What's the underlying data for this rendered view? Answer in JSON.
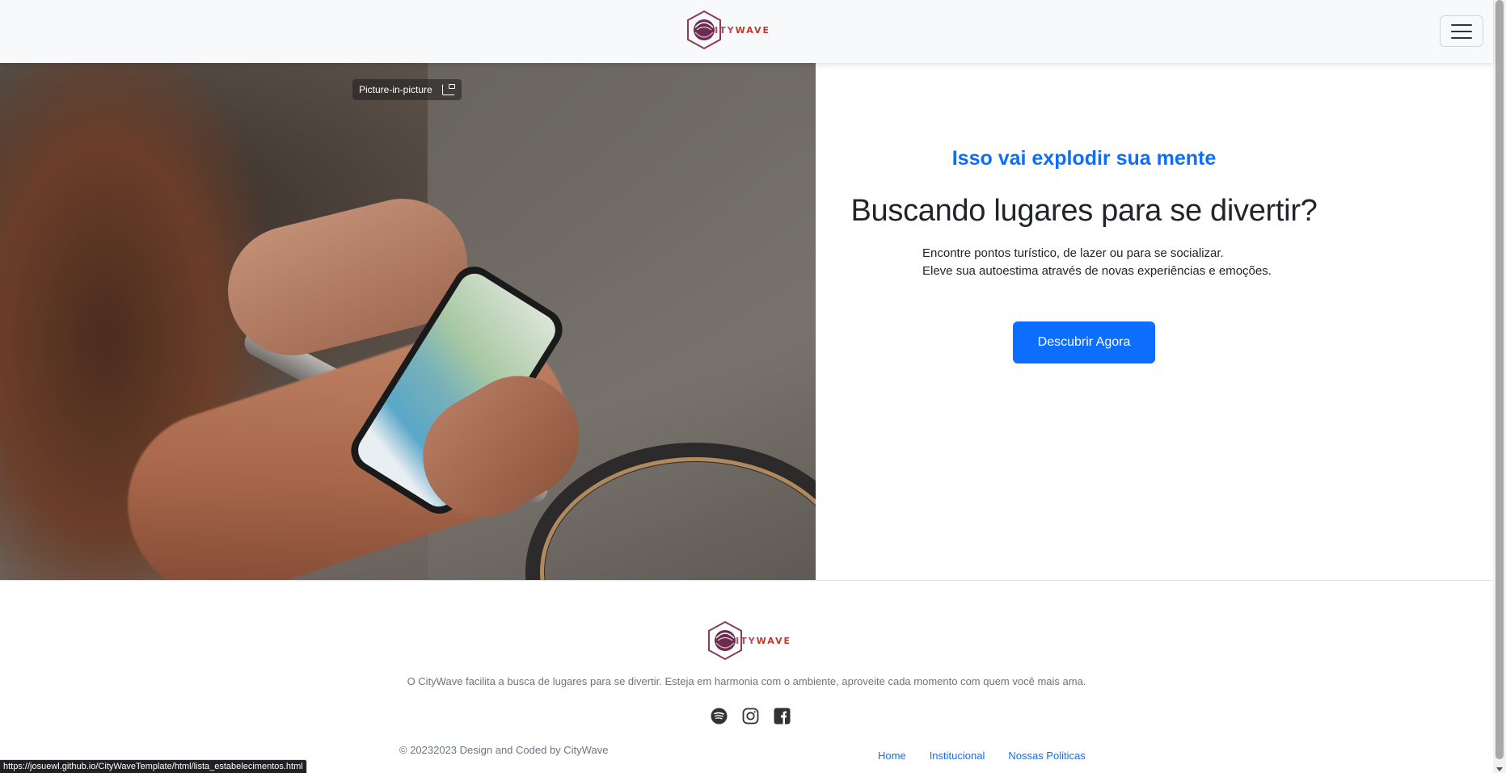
{
  "brand": {
    "name_part1": "CITY",
    "name_part2": "WAVE"
  },
  "header": {
    "menu_toggle_label": "Toggle navigation"
  },
  "video": {
    "pip_label": "Picture-in-picture"
  },
  "hero": {
    "eyebrow": "Isso vai explodir sua mente",
    "headline": "Buscando lugares para se divertir?",
    "desc_line1": "Encontre pontos turístico, de lazer ou para se socializar.",
    "desc_line2": "Eleve sua autoestima através de novas experiências e emoções.",
    "cta_label": "Descubrir Agora"
  },
  "footer": {
    "tagline": "O CityWave facilita a busca de lugares para se divertir. Esteja em harmonia com o ambiente, aproveite cada momento com quem você mais ama.",
    "socials": [
      "spotify-icon",
      "instagram-icon",
      "facebook-icon"
    ],
    "copyright": "© 20232023 Design and Coded by CityWave",
    "links": [
      "Home",
      "Institucional",
      "Nossas Politicas"
    ]
  },
  "status_bar": {
    "url": "https://josuewl.github.io/CityWaveTemplate/html/lista_estabelecimentos.html"
  },
  "colors": {
    "primary": "#0d6efd",
    "navbar_bg": "#f8f9fa",
    "logo_accent": "#b8485c"
  }
}
